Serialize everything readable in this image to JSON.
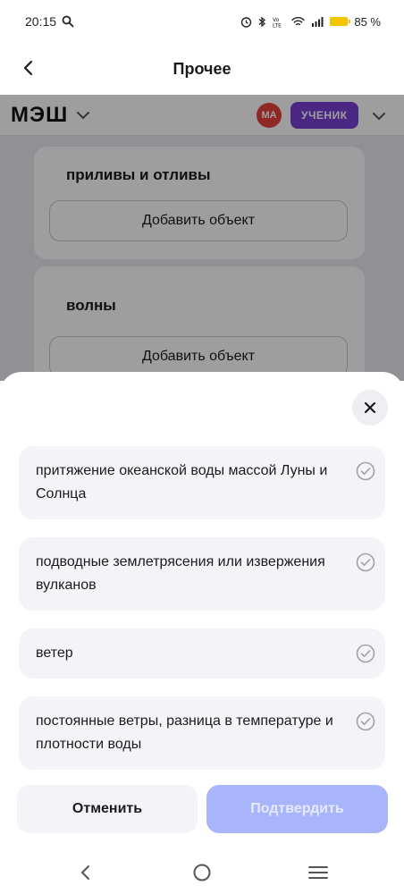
{
  "status_bar": {
    "time": "20:15",
    "battery_percent": "85 %",
    "icons": [
      "search-icon",
      "alarm-icon",
      "bluetooth-icon",
      "volte-icon",
      "wifi-icon",
      "signal-icon",
      "battery-icon"
    ]
  },
  "header": {
    "title": "Прочее"
  },
  "webview": {
    "logo": "МЭШ",
    "avatar_initials": "МА",
    "role": "УЧЕНИК",
    "cards": [
      {
        "title": "приливы и отливы",
        "button": "Добавить объект"
      },
      {
        "title": "волны",
        "button": "Добавить объект"
      }
    ]
  },
  "sheet": {
    "options": [
      {
        "label": "притяжение океанской воды массой Луны и Солнца"
      },
      {
        "label": "подводные землетрясения или извержения вулканов"
      },
      {
        "label": "ветер"
      },
      {
        "label": "постоянные ветры, разница в температуре и плотности воды"
      }
    ],
    "cancel_label": "Отменить",
    "confirm_label": "Подтвердить"
  },
  "colors": {
    "accent_purple": "#7a3fd6",
    "avatar_red": "#e8433e",
    "confirm_disabled": "#a9b5fb",
    "option_bg": "#f4f4f8",
    "battery_yellow": "#f5c400"
  }
}
